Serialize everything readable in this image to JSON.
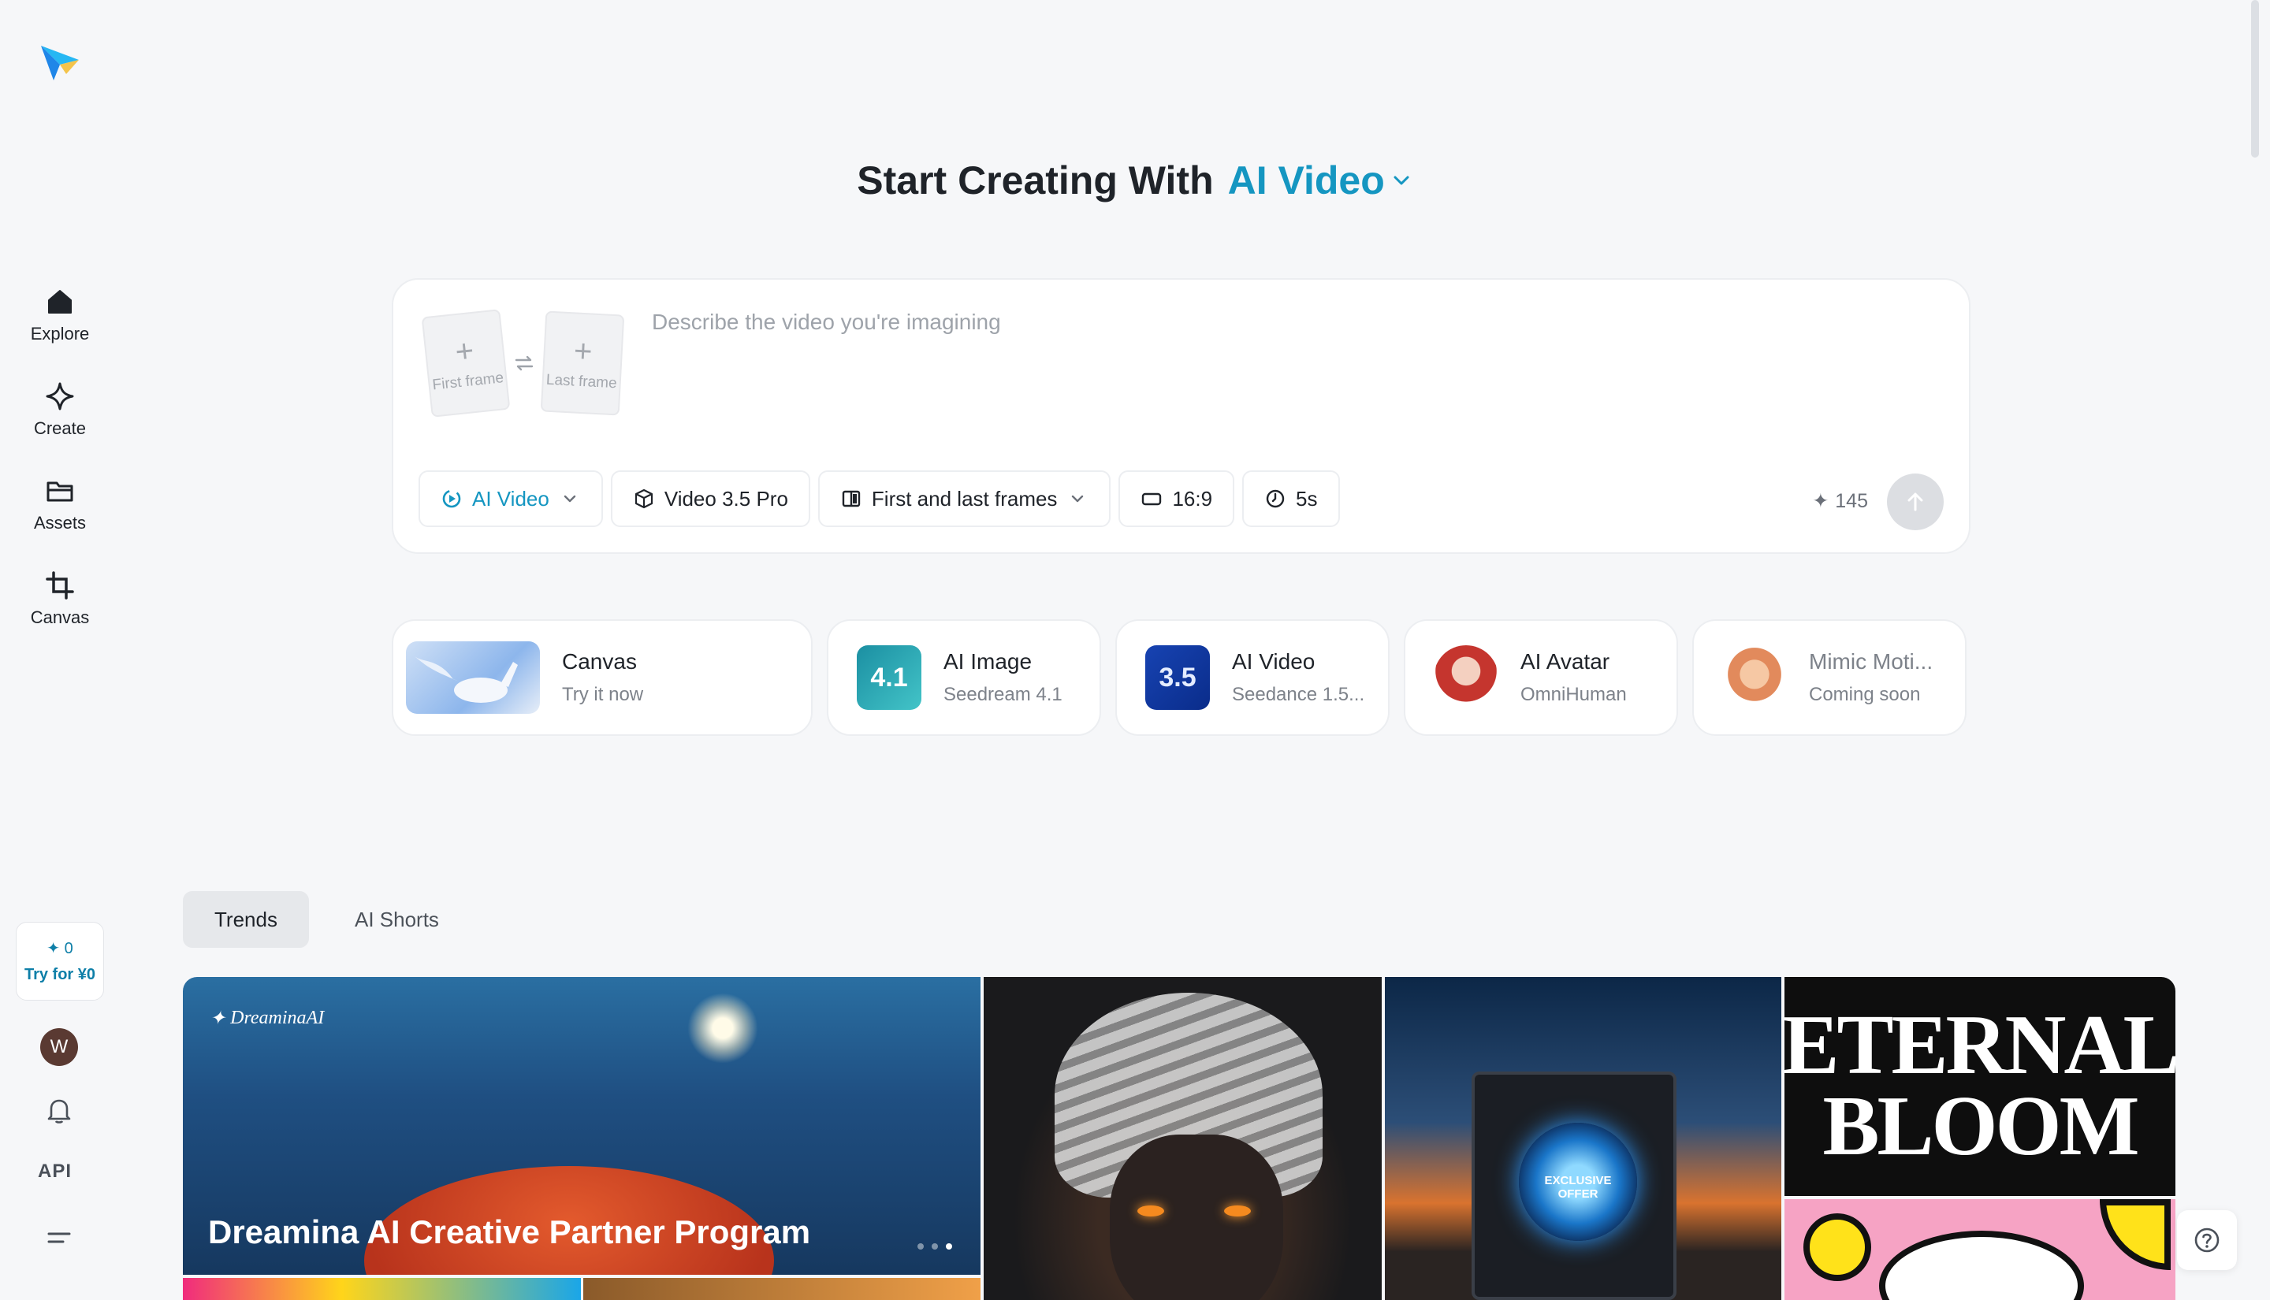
{
  "sidebar": {
    "items": [
      {
        "label": "Explore",
        "icon": "home-icon"
      },
      {
        "label": "Create",
        "icon": "sparkle-icon"
      },
      {
        "label": "Assets",
        "icon": "folder-icon"
      },
      {
        "label": "Canvas",
        "icon": "crop-icon"
      }
    ],
    "credits": {
      "count": "0",
      "cta": "Try for ¥0"
    },
    "avatar_initial": "W",
    "api_label": "API"
  },
  "hero": {
    "prefix": "Start Creating With",
    "mode": "AI Video"
  },
  "prompt": {
    "first_frame_label": "First frame",
    "last_frame_label": "Last frame",
    "placeholder": "Describe the video you're imagining",
    "value": "",
    "chips": {
      "mode": "AI Video",
      "model": "Video 3.5 Pro",
      "frames": "First and last frames",
      "ratio": "16:9",
      "duration": "5s"
    },
    "cost": "145"
  },
  "tools": [
    {
      "title": "Canvas",
      "subtitle": "Try it now"
    },
    {
      "title": "AI Image",
      "subtitle": "Seedream 4.1",
      "badge": "4.1"
    },
    {
      "title": "AI Video",
      "subtitle": "Seedance 1.5...",
      "badge": "3.5"
    },
    {
      "title": "AI Avatar",
      "subtitle": "OmniHuman"
    },
    {
      "title": "Mimic Moti...",
      "subtitle": "Coming soon"
    }
  ],
  "tabs": [
    {
      "label": "Trends"
    },
    {
      "label": "AI Shorts"
    }
  ],
  "gallery": {
    "banner_brand": "DreaminaAI",
    "banner_title": "Dreamina AI Creative Partner Program",
    "washer_text": "EXCLUSIVE OFFER",
    "bloom_line1": "ETERNAL",
    "bloom_line2": "BLOOM"
  },
  "colors": {
    "accent": "#1596c1",
    "background": "#f6f7f9"
  }
}
